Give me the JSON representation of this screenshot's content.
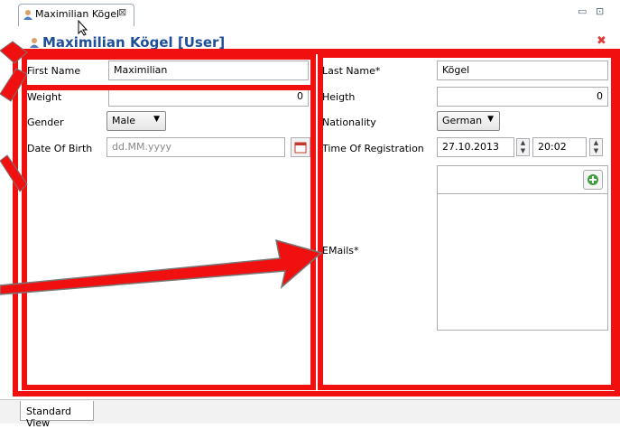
{
  "window": {
    "tab_title": "Maximilian Kögel",
    "tab_close": "⊠",
    "minimize": "▭",
    "maximize": "⊡"
  },
  "header": {
    "title": "Maximilian Kögel [User]",
    "close": "✖"
  },
  "left": {
    "first_name_label": "First Name",
    "first_name_value": "Maximilian",
    "weight_label": "Weight",
    "weight_value": "0",
    "gender_label": "Gender",
    "gender_value": "Male",
    "dob_label": "Date Of Birth",
    "dob_placeholder": "dd.MM.yyyy"
  },
  "right": {
    "last_name_label": "Last Name*",
    "last_name_value": "Kögel",
    "height_label": "Heigth",
    "height_value": "0",
    "nationality_label": "Nationality",
    "nationality_value": "German",
    "registration_label": "Time Of Registration",
    "registration_date": "27.10.2013",
    "registration_time": "20:02",
    "emails_label": "EMails*"
  },
  "footer": {
    "tab_label": "Standard View"
  },
  "colors": {
    "annotation": "#f01010",
    "title": "#1e4f99"
  }
}
